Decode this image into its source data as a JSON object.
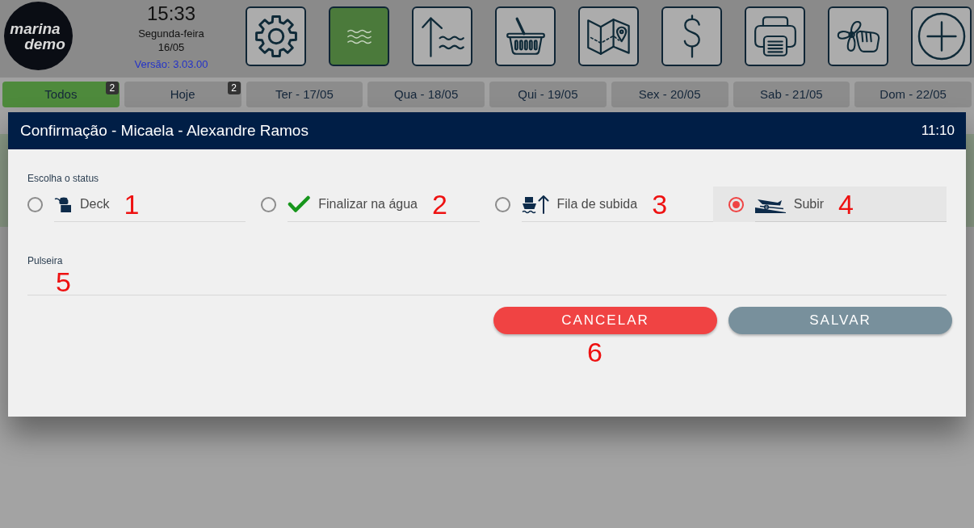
{
  "header": {
    "logo": {
      "line_1": "marina",
      "line_2": "demo"
    },
    "clock": {
      "time": "15:33",
      "weekday": "Segunda-feira",
      "date": "16/05",
      "version": "Versão: 3.03.00"
    },
    "toolbar": [
      {
        "kind": "settings",
        "selected": false
      },
      {
        "kind": "water",
        "selected": true
      },
      {
        "kind": "launch",
        "selected": false
      },
      {
        "kind": "shop",
        "selected": false
      },
      {
        "kind": "map",
        "selected": false
      },
      {
        "kind": "payments",
        "selected": false
      },
      {
        "kind": "print",
        "selected": false
      },
      {
        "kind": "service",
        "selected": false
      },
      {
        "kind": "add",
        "selected": false
      }
    ]
  },
  "day_tabs": [
    {
      "label": "Todos",
      "selected": true,
      "badge": "2"
    },
    {
      "label": "Hoje",
      "selected": false,
      "badge": "2"
    },
    {
      "label": "Ter - 17/05",
      "selected": false
    },
    {
      "label": "Qua - 18/05",
      "selected": false
    },
    {
      "label": "Qui - 19/05",
      "selected": false
    },
    {
      "label": "Sex - 20/05",
      "selected": false
    },
    {
      "label": "Sab - 21/05",
      "selected": false
    },
    {
      "label": "Dom - 22/05",
      "selected": false
    }
  ],
  "dialog": {
    "title": "Confirmação - Micaela - Alexandre Ramos",
    "time": "11:10",
    "status_label": "Escolha o status",
    "status_options": [
      {
        "kind": "deck",
        "label": "Deck",
        "selected": false,
        "annotation": "1"
      },
      {
        "kind": "check",
        "label": "Finalizar na água",
        "selected": false,
        "annotation": "2"
      },
      {
        "kind": "queue",
        "label": "Fila de subida",
        "selected": false,
        "annotation": "3"
      },
      {
        "kind": "lift",
        "label": "Subir",
        "selected": true,
        "annotation": "4"
      }
    ],
    "bracelet_field": {
      "label": "Pulseira",
      "annotation": "5"
    },
    "buttons": [
      {
        "kind": "cancel",
        "label": "CANCELAR",
        "annotation": "6"
      },
      {
        "kind": "save",
        "label": "SALVAR"
      }
    ]
  }
}
